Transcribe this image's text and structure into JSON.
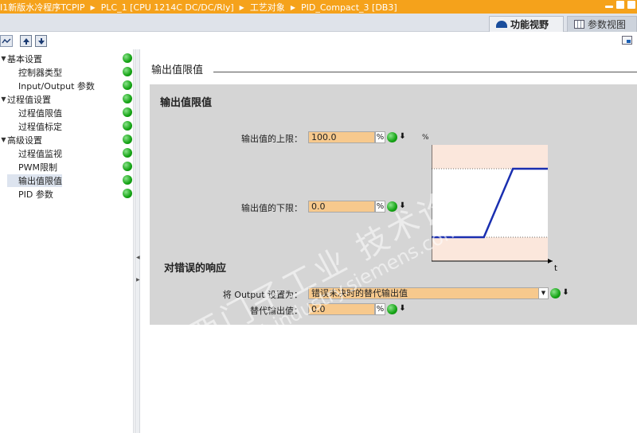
{
  "breadcrumb": [
    "I1新版水冷程序TCPIP",
    "PLC_1 [CPU 1214C DC/DC/Rly]",
    "工艺对象",
    "PID_Compact_3 [DB3]"
  ],
  "view_tabs": {
    "functional": "功能视野",
    "parameter": "参数视图"
  },
  "toolbar": {
    "up_icon": "arrow-up-icon",
    "down_icon": "arrow-down-icon"
  },
  "tree": [
    {
      "label": "基本设置",
      "level": 1,
      "expanded": true
    },
    {
      "label": "控制器类型",
      "level": 2
    },
    {
      "label": "Input/Output 参数",
      "level": 2
    },
    {
      "label": "过程值设置",
      "level": 1,
      "expanded": true
    },
    {
      "label": "过程值限值",
      "level": 2
    },
    {
      "label": "过程值标定",
      "level": 2
    },
    {
      "label": "高级设置",
      "level": 1,
      "expanded": true
    },
    {
      "label": "过程值监视",
      "level": 2
    },
    {
      "label": "PWM限制",
      "level": 2
    },
    {
      "label": "输出值限值",
      "level": 2,
      "selected": true
    },
    {
      "label": "PID 参数",
      "level": 2
    }
  ],
  "main": {
    "section_title": "输出值限值",
    "panel_title": "输出值限值",
    "upper_label": "输出值的上限：",
    "upper_value": "100.0",
    "lower_label": "输出值的下限：",
    "lower_value": "0.0",
    "unit": "%",
    "error_title": "对错误的响应",
    "output_label": "将 Output 设置为：",
    "output_value": "错误未决时的替代输出值",
    "substitute_label": "替代输出值：",
    "substitute_value": "0.0"
  },
  "chart_data": {
    "type": "line",
    "y_axis_label": "%",
    "x_axis_label": "t",
    "series": [
      {
        "x": [
          0,
          0.45,
          0.7,
          1.0
        ],
        "y": [
          0,
          0,
          1,
          1
        ]
      }
    ],
    "upper_limit_line": 1,
    "lower_limit_line": 0
  },
  "watermark": {
    "line1": "西门子工业   技术论坛",
    "line2": "support.industry.siemens.com/cs"
  },
  "colors": {
    "title_bar": "#f5a21b",
    "field_fill": "#f7c98d",
    "status_ok": "#14a314",
    "chart_line": "#1a2fb0",
    "chart_band": "#fbe7dc"
  }
}
